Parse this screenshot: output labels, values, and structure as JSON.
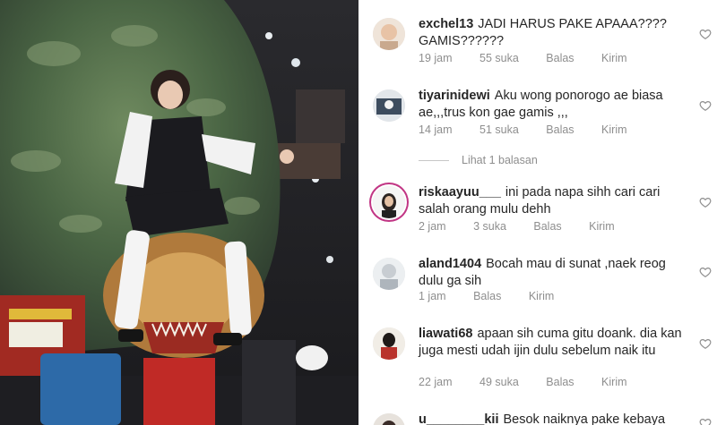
{
  "comments": [
    {
      "user": "exchel13",
      "text": "JADI HARUS PAKE APAAA???? GAMIS??????",
      "time": "19 jam",
      "likes": "55 suka",
      "reply": "Balas",
      "send": "Kirim"
    },
    {
      "user": "tiyarinidewi",
      "text": "Aku wong ponorogo ae biasa ae,,,trus kon gae gamis ,,,",
      "time": "14 jam",
      "likes": "51 suka",
      "reply": "Balas",
      "send": "Kirim"
    },
    {
      "user": "riskaayuu___",
      "text": "ini pada napa sihh cari cari salah orang mulu dehh",
      "time": "2 jam",
      "likes": "3 suka",
      "reply": "Balas",
      "send": "Kirim"
    },
    {
      "user": "aland1404",
      "text": "Bocah mau di sunat ,naek reog dulu ga sih",
      "time": "1 jam",
      "reply": "Balas",
      "send": "Kirim"
    },
    {
      "user": "liawati68",
      "text": "apaan sih cuma gitu doank. dia kan juga mesti udah ijin dulu sebelum naik itu",
      "time": "22 jam",
      "likes": "49 suka",
      "reply": "Balas",
      "send": "Kirim"
    },
    {
      "user": "u________kii",
      "text": "Besok naiknya pake kebaya"
    }
  ],
  "view_replies": "Lihat 1 balasan",
  "colors": {
    "meta": "#8e8e8e",
    "text": "#262626",
    "story_ring": "#c13584"
  },
  "icons": {
    "like": "heart-outline-icon"
  }
}
